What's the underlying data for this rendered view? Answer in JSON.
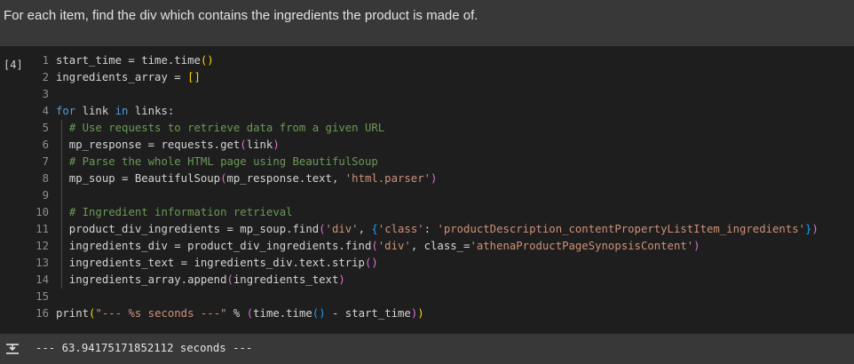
{
  "markdown": {
    "text": "For each item, find the div which contains the ingredients the product is made of."
  },
  "cell": {
    "execution_label": "[4]",
    "lines": [
      {
        "n": "1",
        "tokens": [
          [
            "",
            "start_time = time.time"
          ],
          [
            "pn",
            "("
          ],
          [
            "pn",
            ")"
          ]
        ]
      },
      {
        "n": "2",
        "tokens": [
          [
            "",
            "ingredients_array = "
          ],
          [
            "pn",
            "[]"
          ]
        ]
      },
      {
        "n": "3",
        "tokens": []
      },
      {
        "n": "4",
        "tokens": [
          [
            "kw",
            "for"
          ],
          [
            "",
            " link "
          ],
          [
            "kw",
            "in"
          ],
          [
            "",
            " links:"
          ]
        ]
      },
      {
        "n": "5",
        "tokens": [
          [
            "",
            "  "
          ],
          [
            "cm",
            "# Use requests to retrieve data from a given URL"
          ]
        ]
      },
      {
        "n": "6",
        "tokens": [
          [
            "",
            "  mp_response = requests.get"
          ],
          [
            "pn2",
            "("
          ],
          [
            "",
            "link"
          ],
          [
            "pn2",
            ")"
          ]
        ]
      },
      {
        "n": "7",
        "tokens": [
          [
            "",
            "  "
          ],
          [
            "cm",
            "# Parse the whole HTML page using BeautifulSoup"
          ]
        ]
      },
      {
        "n": "8",
        "tokens": [
          [
            "",
            "  mp_soup = BeautifulSoup"
          ],
          [
            "pn2",
            "("
          ],
          [
            "",
            "mp_response.text, "
          ],
          [
            "st",
            "'html.parser'"
          ],
          [
            "pn2",
            ")"
          ]
        ]
      },
      {
        "n": "9",
        "tokens": []
      },
      {
        "n": "10",
        "tokens": [
          [
            "",
            "  "
          ],
          [
            "cm",
            "# Ingredient information retrieval"
          ]
        ]
      },
      {
        "n": "11",
        "tokens": [
          [
            "",
            "  product_div_ingredients = mp_soup.find"
          ],
          [
            "pn2",
            "("
          ],
          [
            "st",
            "'div'"
          ],
          [
            "",
            ", "
          ],
          [
            "pn3",
            "{"
          ],
          [
            "st",
            "'class'"
          ],
          [
            "",
            ": "
          ],
          [
            "st",
            "'productDescription_contentPropertyListItem_ingredients'"
          ],
          [
            "pn3",
            "}"
          ],
          [
            "pn2",
            ")"
          ]
        ]
      },
      {
        "n": "12",
        "tokens": [
          [
            "",
            "  ingredients_div = product_div_ingredients.find"
          ],
          [
            "pn2",
            "("
          ],
          [
            "st",
            "'div'"
          ],
          [
            "",
            ", class_="
          ],
          [
            "st",
            "'athenaProductPageSynopsisContent'"
          ],
          [
            "pn2",
            ")"
          ]
        ]
      },
      {
        "n": "13",
        "tokens": [
          [
            "",
            "  ingredients_text = ingredients_div.text.strip"
          ],
          [
            "pn2",
            "("
          ],
          [
            "pn2",
            ")"
          ]
        ]
      },
      {
        "n": "14",
        "tokens": [
          [
            "",
            "  ingredients_array.append"
          ],
          [
            "pn2",
            "("
          ],
          [
            "",
            "ingredients_text"
          ],
          [
            "pn2",
            ")"
          ]
        ]
      },
      {
        "n": "15",
        "tokens": []
      },
      {
        "n": "16",
        "tokens": [
          [
            "",
            "print"
          ],
          [
            "pn",
            "("
          ],
          [
            "st",
            "\"--- %s seconds ---\""
          ],
          [
            "",
            " % "
          ],
          [
            "pn2",
            "("
          ],
          [
            "",
            "time.time"
          ],
          [
            "pn3",
            "("
          ],
          [
            "pn3",
            ")"
          ],
          [
            "",
            " - start_time"
          ],
          [
            "pn2",
            ")"
          ],
          [
            "pn",
            ")"
          ]
        ]
      }
    ]
  },
  "output": {
    "icon": "output-toggle-icon",
    "text": "--- 63.94175171852112 seconds ---"
  },
  "colors": {
    "keyword": "#569cd6",
    "comment": "#6a9955",
    "string": "#ce9178",
    "background": "#1e1e1e"
  }
}
